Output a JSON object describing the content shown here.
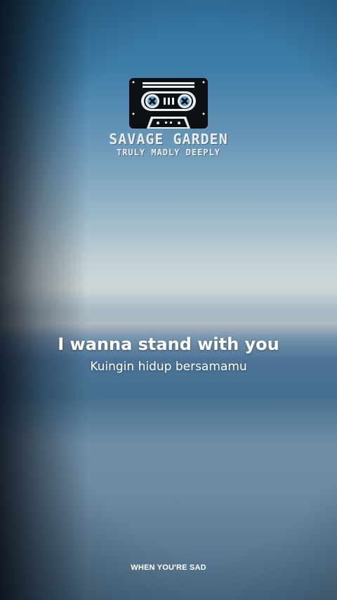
{
  "logo": {
    "icon": "cassette-tape-icon",
    "band": "SAVAGE GARDEN",
    "song": "TRULY MADLY DEEPLY"
  },
  "lyrics": {
    "line": "I wanna stand with you",
    "translation": "Kuingin hidup bersamamu"
  },
  "footer": {
    "text": "WHEN YOU'RE SAD"
  },
  "colors": {
    "sky_top": "#2f6f9c",
    "horizon": "#cdd7d8",
    "clouds": "#46708f",
    "text": "#ffffff"
  }
}
